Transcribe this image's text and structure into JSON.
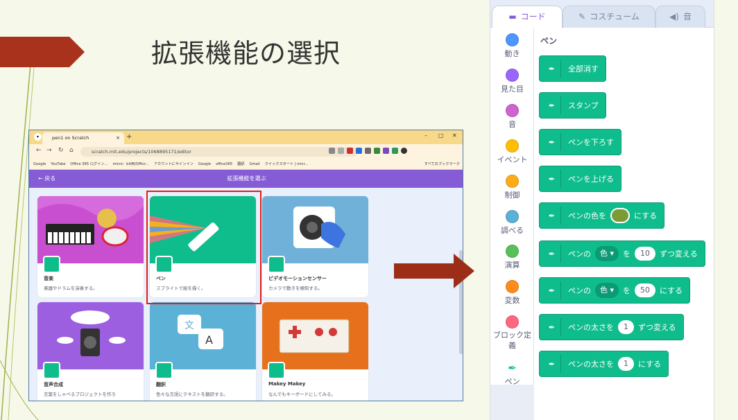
{
  "slide": {
    "title": "拡張機能の選択"
  },
  "browser": {
    "tab_title": "pen1 on Scratch",
    "url": "scratch.mit.edu/projects/1068895171/editor",
    "bookmarks": [
      "Google",
      "YouTube",
      "Office 365 ログイン...",
      "micro：bit用のMicr...",
      "アカウントにサインイン",
      "Google",
      "office365",
      "翻訳",
      "Gmail",
      "クイックスタート | micr..."
    ],
    "bookmarks_all": "すべてのブックマーク",
    "scratch_header": {
      "back_label": "戻る",
      "title": "拡張機能を選ぶ"
    },
    "cards": [
      {
        "title": "音楽",
        "desc": "楽器やドラムを演奏する。",
        "color": "#c94fd1"
      },
      {
        "title": "ペン",
        "desc": "スプライトで絵を描く。",
        "color": "#0fbd8c"
      },
      {
        "title": "ビデオモーションセンサー",
        "desc": "カメラで動きを検知する。",
        "color": "#4ca4d6"
      },
      {
        "title": "音声合成",
        "desc": "言葉をしゃべるプロジェクトを作ろ",
        "color": "#9c5fe0"
      },
      {
        "title": "翻訳",
        "desc": "色々な言語にテキストを翻訳する。",
        "color": "#5cb1d6"
      },
      {
        "title": "Makey Makey",
        "desc": "なんでもキーボードにしてみる。",
        "color": "#e6701b"
      }
    ]
  },
  "palette": {
    "tabs": [
      {
        "label": "コード",
        "icon": "code-icon"
      },
      {
        "label": "コスチューム",
        "icon": "brush-icon"
      },
      {
        "label": "音",
        "icon": "speaker-icon"
      }
    ],
    "categories": [
      {
        "label": "動き",
        "color": "#4c97ff"
      },
      {
        "label": "見た目",
        "color": "#9966ff"
      },
      {
        "label": "音",
        "color": "#cf63cf"
      },
      {
        "label": "イベント",
        "color": "#ffbf00"
      },
      {
        "label": "制御",
        "color": "#ffab19"
      },
      {
        "label": "調べる",
        "color": "#5cb1d6"
      },
      {
        "label": "演算",
        "color": "#59c059"
      },
      {
        "label": "変数",
        "color": "#ff8c1a"
      },
      {
        "label": "ブロック定義",
        "color": "#ff6680"
      },
      {
        "label": "ペン",
        "color": "#0fbd8c"
      }
    ],
    "section_title": "ペン",
    "blocks": {
      "clear": "全部消す",
      "stamp": "スタンプ",
      "pen_down": "ペンを下ろす",
      "pen_up": "ペンを上げる",
      "set_color_pre": "ペンの色を",
      "set_color_post": "にする",
      "change_param_pre": "ペンの",
      "change_param_dd": "色",
      "change_param_mid": "を",
      "change_param_val": "10",
      "change_param_post": "ずつ変える",
      "set_param_pre": "ペンの",
      "set_param_dd": "色",
      "set_param_mid": "を",
      "set_param_val": "50",
      "set_param_post": "にする",
      "change_size_pre": "ペンの太さを",
      "change_size_val": "1",
      "change_size_post": "ずつ変える",
      "set_size_pre": "ペンの太さを",
      "set_size_val": "1",
      "set_size_post": "にする"
    }
  }
}
